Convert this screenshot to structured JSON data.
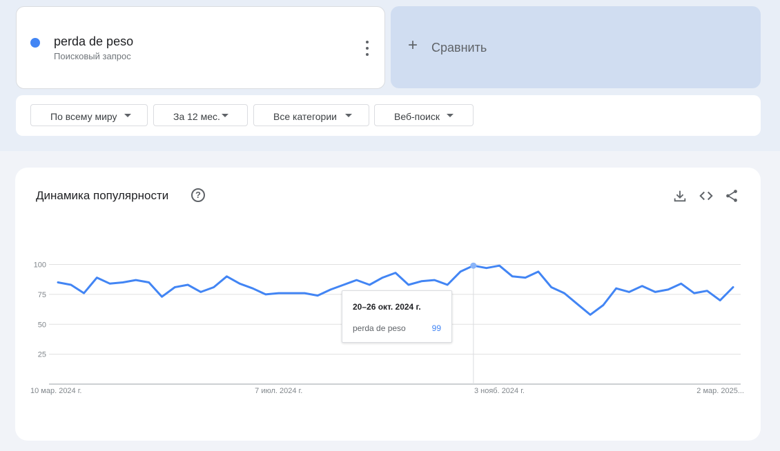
{
  "term": {
    "name": "perda de peso",
    "type": "Поисковый запрос",
    "color": "#4285f4"
  },
  "compare": {
    "label": "Сравнить"
  },
  "filters": [
    {
      "label": "По всему миру"
    },
    {
      "label": "За 12 мес."
    },
    {
      "label": "Все категории"
    },
    {
      "label": "Веб-поиск"
    }
  ],
  "chart_card": {
    "title": "Динамика популярности",
    "help_icon": "help-circle-icon",
    "tools": [
      "download-icon",
      "embed-code-icon",
      "share-icon"
    ]
  },
  "tooltip": {
    "date": "20–26 окт. 2024 г.",
    "term": "perda de peso",
    "value": "99"
  },
  "chart_data": {
    "type": "line",
    "title": "Динамика популярности",
    "ylim": [
      0,
      100
    ],
    "y_ticks": [
      25,
      50,
      75,
      100
    ],
    "x_tick_labels": [
      "10 мар. 2024 г.",
      "7 июл. 2024 г.",
      "3 нояб. 2024 г.",
      "2 мар. 2025..."
    ],
    "x_tick_indices": [
      0,
      17,
      34,
      51
    ],
    "grid": true,
    "highlight_index": 32,
    "series": [
      {
        "name": "perda de peso",
        "color": "#4285f4",
        "values": [
          85,
          83,
          76,
          89,
          84,
          85,
          87,
          85,
          73,
          81,
          83,
          77,
          81,
          90,
          84,
          80,
          75,
          76,
          76,
          76,
          74,
          79,
          83,
          87,
          83,
          89,
          93,
          83,
          86,
          87,
          83,
          94,
          99,
          97,
          99,
          90,
          89,
          94,
          81,
          76,
          67,
          58,
          66,
          80,
          77,
          82,
          77,
          79,
          84,
          76,
          78,
          70,
          81
        ]
      }
    ]
  }
}
